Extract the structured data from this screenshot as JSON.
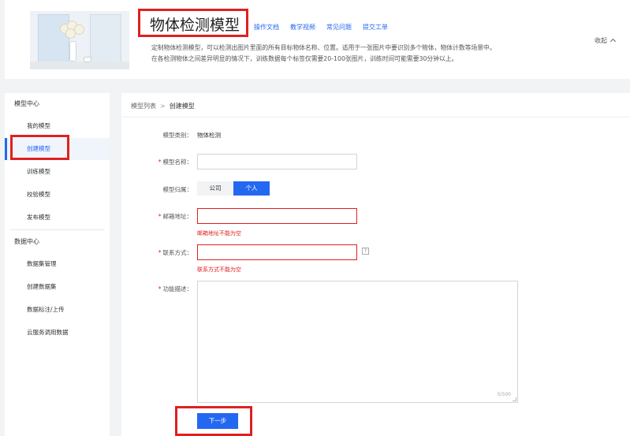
{
  "header": {
    "title": "物体检测模型",
    "links": [
      "操作文档",
      "教学视频",
      "常见问题",
      "提交工单"
    ],
    "desc_line1": "定制物体检测模型，可以检测出图片里面的所有目标物体名称、位置。适用于一张图片中要识别多个物体，物体计数等场景中。",
    "desc_line2": "在各检测物体之间差异明显的情况下，训练数据每个标签仅需要20-100张图片，训练时间可能需要30分钟以上。",
    "collapse_label": "收起"
  },
  "sidebar": {
    "group1": "模型中心",
    "items1": [
      "我的模型",
      "创建模型",
      "训练模型",
      "校验模型",
      "发布模型"
    ],
    "group2": "数据中心",
    "items2": [
      "数据集管理",
      "创建数据集",
      "数据标注/上传",
      "云服务调用数据"
    ],
    "active_item": "创建模型"
  },
  "breadcrumb": {
    "parent": "模型列表",
    "separator": ">",
    "current": "创建模型"
  },
  "form": {
    "type_label": "模型类别：",
    "type_value": "物体检测",
    "name_label": "模型名称：",
    "name_value": "",
    "ownership_label": "模型归属：",
    "ownership_options": [
      "公司",
      "个人"
    ],
    "ownership_selected": "个人",
    "email_label": "邮箱地址：",
    "email_value": "",
    "email_error": "邮箱地址不能为空",
    "phone_label": "联系方式：",
    "phone_value": "",
    "phone_error": "联系方式不能为空",
    "help_glyph": "?",
    "desc_label": "功能描述：",
    "desc_value": "",
    "desc_counter": "0/500",
    "required_mark": "*",
    "next_button": "下一步"
  },
  "colors": {
    "accent": "#2468f2",
    "error": "#e02020",
    "highlight_box": "#e02020"
  },
  "icons": {
    "help": "help-icon",
    "collapse": "chevron-up-icon"
  }
}
